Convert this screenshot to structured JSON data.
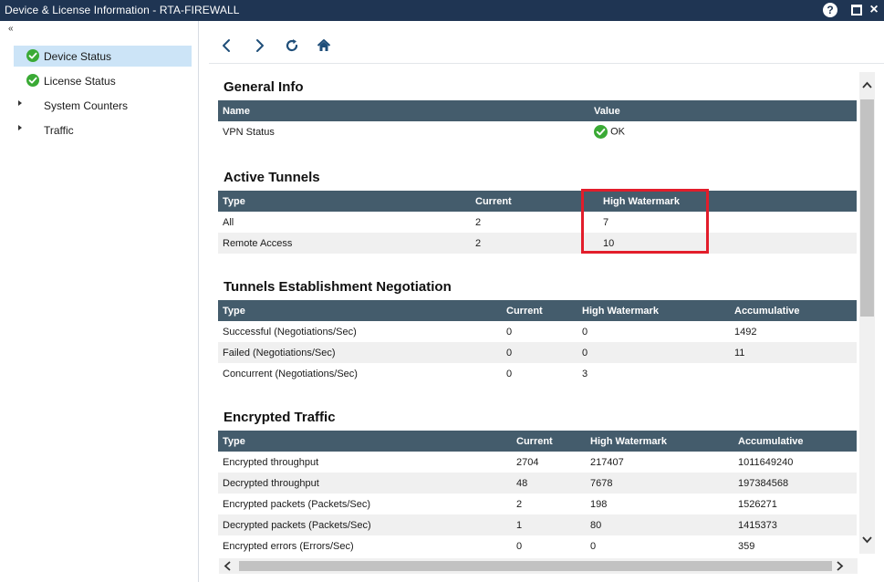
{
  "window": {
    "title": "Device & License Information - RTA-FIREWALL",
    "help_label": "?"
  },
  "sidebar": {
    "collapse_label": "«",
    "items": [
      {
        "label": "Device Status",
        "icon": "ok-check-icon",
        "selected": true
      },
      {
        "label": "License Status",
        "icon": "ok-check-icon",
        "selected": false
      },
      {
        "label": "System Counters",
        "icon": "expand-arrow-icon",
        "selected": false
      },
      {
        "label": "Traffic",
        "icon": "expand-arrow-icon",
        "selected": false
      }
    ]
  },
  "toolbar": {
    "icons": [
      "back-icon",
      "forward-icon",
      "refresh-icon",
      "home-icon"
    ]
  },
  "general_info": {
    "title": "General Info",
    "headers": [
      "Name",
      "Value"
    ],
    "rows": [
      {
        "name": "VPN Status",
        "value": "OK"
      }
    ]
  },
  "active_tunnels": {
    "title": "Active Tunnels",
    "headers": [
      "Type",
      "Current",
      "High Watermark"
    ],
    "rows": [
      [
        "All",
        "2",
        "7"
      ],
      [
        "Remote Access",
        "2",
        "10"
      ]
    ]
  },
  "tunnels_negotiation": {
    "title": "Tunnels Establishment Negotiation",
    "headers": [
      "Type",
      "Current",
      "High Watermark",
      "Accumulative"
    ],
    "rows": [
      [
        "Successful (Negotiations/Sec)",
        "0",
        "0",
        "1492"
      ],
      [
        "Failed (Negotiations/Sec)",
        "0",
        "0",
        "11"
      ],
      [
        "Concurrent (Negotiations/Sec)",
        "0",
        "3",
        ""
      ]
    ]
  },
  "encrypted_traffic": {
    "title": "Encrypted Traffic",
    "headers": [
      "Type",
      "Current",
      "High Watermark",
      "Accumulative"
    ],
    "rows": [
      [
        "Encrypted throughput",
        "2704",
        "217407",
        "1011649240"
      ],
      [
        "Decrypted throughput",
        "48",
        "7678",
        "197384568"
      ],
      [
        "Encrypted packets (Packets/Sec)",
        "2",
        "198",
        "1526271"
      ],
      [
        "Decrypted packets (Packets/Sec)",
        "1",
        "80",
        "1415373"
      ],
      [
        "Encrypted errors (Errors/Sec)",
        "0",
        "0",
        "359"
      ]
    ]
  },
  "colors": {
    "titlebar": "#1f3553",
    "table_header": "#445c6c",
    "selection": "#cce4f7",
    "ok_green": "#3aaa35",
    "highlight_red": "#e21d2b"
  }
}
